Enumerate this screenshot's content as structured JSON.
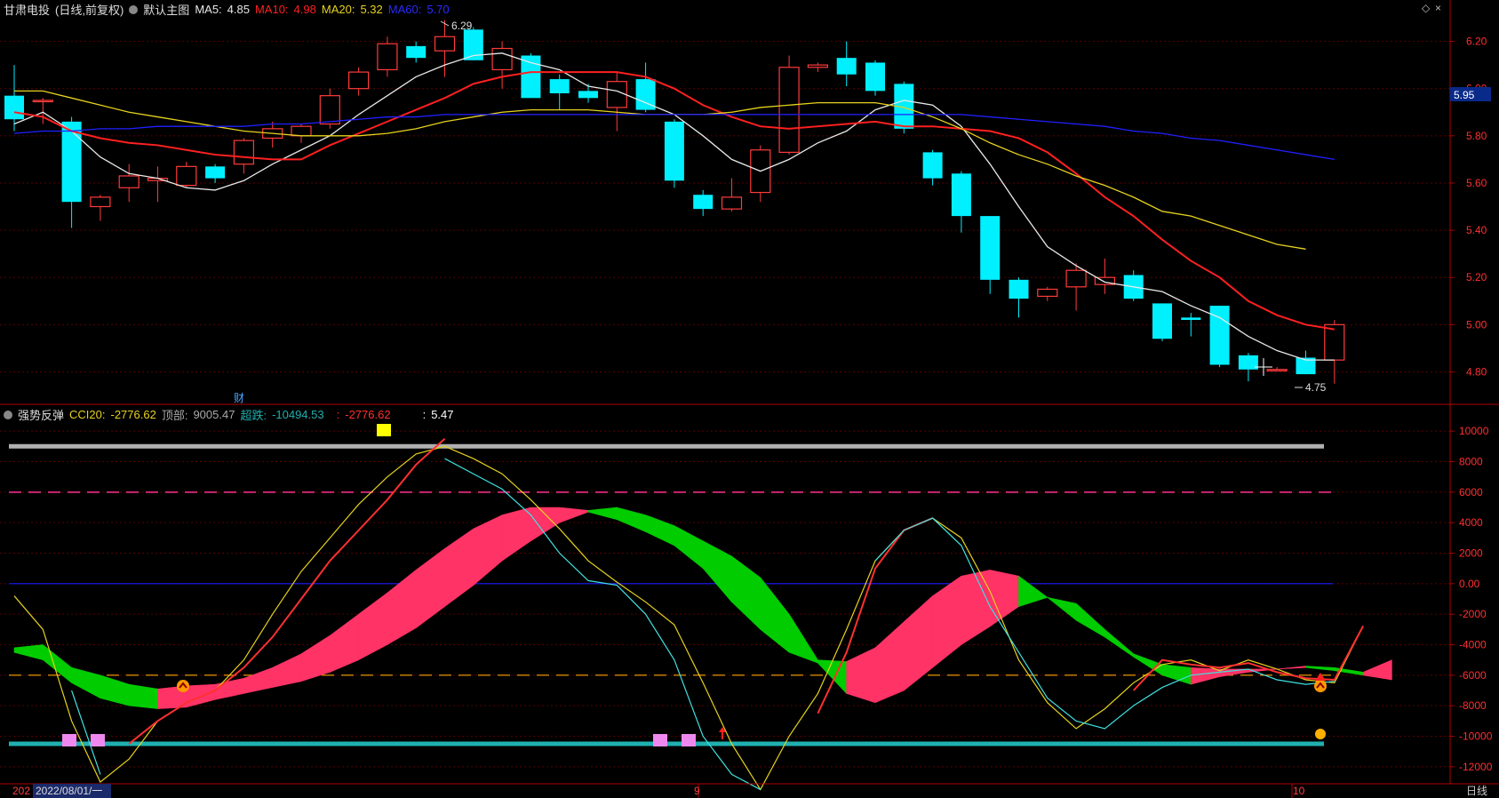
{
  "main_header": {
    "stock": "甘肃电投",
    "period": "(日线,前复权)",
    "theme": "默认主图",
    "ma5": {
      "label": "MA5:",
      "value": "4.85",
      "color": "#e8e8e8"
    },
    "ma10": {
      "label": "MA10:",
      "value": "4.98",
      "color": "#ff2020"
    },
    "ma20": {
      "label": "MA20:",
      "value": "5.32",
      "color": "#e6d21e"
    },
    "ma60": {
      "label": "MA60:",
      "value": "5.70",
      "color": "#2020ff"
    }
  },
  "sub_header": {
    "name": "强势反弹",
    "cci": {
      "label": "CCI20:",
      "value": "-2776.62",
      "color": "#e6d21e"
    },
    "top": {
      "label": "顶部:",
      "value": "9005.47",
      "color": "#aaaaaa"
    },
    "oversold": {
      "label": "超跌:",
      "value": "-10494.53",
      "color": "#20b0b0"
    },
    "red": {
      "label": ":",
      "value": "-2776.62",
      "color": "#ff3030"
    },
    "white": {
      "label": ":",
      "value": "5.47",
      "color": "#ffffff"
    }
  },
  "price_tag": "5.95",
  "finance_marker": "财",
  "annotations": {
    "high": "6.29",
    "low": "4.75"
  },
  "x_labels": {
    "start": "202",
    "cursor_date": "2022/08/01/一",
    "m9": "9",
    "m10": "10",
    "period": "日线"
  },
  "chart_data": [
    {
      "type": "candlestick",
      "title": "甘肃电投 (日线,前复权)",
      "ylim": [
        4.7,
        6.3
      ],
      "yticks": [
        4.8,
        5.0,
        5.2,
        5.4,
        5.6,
        5.8,
        6.0,
        6.2
      ],
      "colors": {
        "up": "#ff3b3b",
        "down": "#00f0ff"
      },
      "ohlc": [
        [
          5.97,
          6.1,
          5.82,
          5.87
        ],
        [
          5.95,
          5.96,
          5.85,
          5.95
        ],
        [
          5.86,
          5.88,
          5.41,
          5.52
        ],
        [
          5.5,
          5.55,
          5.44,
          5.54
        ],
        [
          5.58,
          5.68,
          5.52,
          5.63
        ],
        [
          5.61,
          5.67,
          5.52,
          5.62
        ],
        [
          5.59,
          5.69,
          5.58,
          5.67
        ],
        [
          5.67,
          5.68,
          5.6,
          5.62
        ],
        [
          5.68,
          5.79,
          5.64,
          5.78
        ],
        [
          5.79,
          5.86,
          5.75,
          5.83
        ],
        [
          5.8,
          5.85,
          5.77,
          5.84
        ],
        [
          5.85,
          6.0,
          5.83,
          5.97
        ],
        [
          6.0,
          6.09,
          5.97,
          6.07
        ],
        [
          6.08,
          6.22,
          6.05,
          6.19
        ],
        [
          6.18,
          6.2,
          6.11,
          6.13
        ],
        [
          6.16,
          6.29,
          6.05,
          6.22
        ],
        [
          6.25,
          6.26,
          6.12,
          6.12
        ],
        [
          6.08,
          6.2,
          6.0,
          6.17
        ],
        [
          6.14,
          6.15,
          5.98,
          5.96
        ],
        [
          6.04,
          6.06,
          5.91,
          5.98
        ],
        [
          5.99,
          6.02,
          5.94,
          5.96
        ],
        [
          5.92,
          6.07,
          5.82,
          6.03
        ],
        [
          6.04,
          6.11,
          5.9,
          5.91
        ],
        [
          5.86,
          5.87,
          5.58,
          5.61
        ],
        [
          5.55,
          5.57,
          5.46,
          5.49
        ],
        [
          5.49,
          5.62,
          5.48,
          5.54
        ],
        [
          5.56,
          5.76,
          5.52,
          5.74
        ],
        [
          5.73,
          6.14,
          5.72,
          6.09
        ],
        [
          6.09,
          6.11,
          6.07,
          6.1
        ],
        [
          6.13,
          6.2,
          6.01,
          6.06
        ],
        [
          6.11,
          6.12,
          5.97,
          5.99
        ],
        [
          6.02,
          6.03,
          5.81,
          5.83
        ],
        [
          5.73,
          5.74,
          5.59,
          5.62
        ],
        [
          5.64,
          5.65,
          5.39,
          5.46
        ],
        [
          5.46,
          5.46,
          5.13,
          5.19
        ],
        [
          5.19,
          5.2,
          5.03,
          5.11
        ],
        [
          5.12,
          5.16,
          5.1,
          5.15
        ],
        [
          5.16,
          5.26,
          5.06,
          5.23
        ],
        [
          5.17,
          5.28,
          5.13,
          5.2
        ],
        [
          5.21,
          5.23,
          5.1,
          5.11
        ],
        [
          5.09,
          5.09,
          4.93,
          4.94
        ],
        [
          5.03,
          5.05,
          4.95,
          5.02
        ],
        [
          5.08,
          5.08,
          4.82,
          4.83
        ],
        [
          4.87,
          4.88,
          4.76,
          4.81
        ],
        [
          4.81,
          4.82,
          4.81,
          4.81
        ],
        [
          4.86,
          4.89,
          4.79,
          4.79
        ],
        [
          4.85,
          5.02,
          4.75,
          5.0
        ]
      ],
      "series": [
        {
          "name": "MA5",
          "color": "#e8e8e8",
          "values": [
            5.85,
            5.9,
            5.82,
            5.71,
            5.64,
            5.62,
            5.58,
            5.57,
            5.61,
            5.68,
            5.74,
            5.8,
            5.89,
            5.97,
            6.05,
            6.1,
            6.14,
            6.15,
            6.11,
            6.08,
            6.01,
            5.99,
            5.94,
            5.89,
            5.8,
            5.7,
            5.65,
            5.7,
            5.77,
            5.82,
            5.91,
            5.95,
            5.93,
            5.84,
            5.68,
            5.5,
            5.33,
            5.25,
            5.18,
            5.16,
            5.14,
            5.08,
            5.03,
            4.95,
            4.89,
            4.85,
            4.85
          ]
        },
        {
          "name": "MA10",
          "color": "#ff2020",
          "values": [
            5.9,
            5.88,
            5.82,
            5.79,
            5.77,
            5.76,
            5.74,
            5.72,
            5.71,
            5.7,
            5.7,
            5.76,
            5.81,
            5.86,
            5.91,
            5.96,
            6.02,
            6.05,
            6.07,
            6.07,
            6.07,
            6.07,
            6.05,
            6.0,
            5.93,
            5.88,
            5.84,
            5.83,
            5.84,
            5.85,
            5.86,
            5.84,
            5.84,
            5.83,
            5.82,
            5.79,
            5.73,
            5.64,
            5.54,
            5.46,
            5.36,
            5.27,
            5.2,
            5.1,
            5.04,
            5.0,
            4.98
          ]
        },
        {
          "name": "MA20",
          "color": "#e6d21e",
          "values": [
            5.99,
            5.99,
            5.96,
            5.93,
            5.9,
            5.88,
            5.86,
            5.84,
            5.82,
            5.81,
            5.8,
            5.8,
            5.8,
            5.81,
            5.83,
            5.86,
            5.88,
            5.9,
            5.91,
            5.91,
            5.91,
            5.9,
            5.89,
            5.89,
            5.89,
            5.9,
            5.92,
            5.93,
            5.94,
            5.94,
            5.94,
            5.92,
            5.88,
            5.83,
            5.77,
            5.72,
            5.68,
            5.63,
            5.59,
            5.54,
            5.48,
            5.46,
            5.42,
            5.38,
            5.34,
            5.32
          ]
        },
        {
          "name": "MA60",
          "color": "#2020ff",
          "values": [
            5.81,
            5.82,
            5.82,
            5.83,
            5.83,
            5.84,
            5.84,
            5.84,
            5.84,
            5.85,
            5.85,
            5.86,
            5.87,
            5.88,
            5.88,
            5.89,
            5.89,
            5.89,
            5.89,
            5.89,
            5.89,
            5.89,
            5.89,
            5.89,
            5.89,
            5.89,
            5.89,
            5.89,
            5.89,
            5.89,
            5.89,
            5.89,
            5.89,
            5.89,
            5.88,
            5.87,
            5.86,
            5.85,
            5.84,
            5.82,
            5.81,
            5.79,
            5.78,
            5.76,
            5.74,
            5.72,
            5.7
          ]
        }
      ]
    },
    {
      "type": "line",
      "title": "强势反弹",
      "ylim": [
        -13000,
        11000
      ],
      "yticks": [
        10000,
        8000,
        6000,
        4000,
        2000,
        0,
        -2000,
        -4000,
        -6000,
        -8000,
        -10000,
        -12000
      ],
      "hlines": [
        {
          "value": 9005.47,
          "color": "#b0b0b0",
          "style": "solid",
          "width": 5
        },
        {
          "value": 6000,
          "color": "#ff3090",
          "style": "dashed",
          "width": 1.5
        },
        {
          "value": 0,
          "color": "#1a1aff",
          "style": "solid",
          "width": 1.2
        },
        {
          "value": -6000,
          "color": "#ffa500",
          "style": "dashed",
          "width": 1.2
        },
        {
          "value": -10494.53,
          "color": "#20b0b0",
          "style": "solid",
          "width": 5
        }
      ],
      "series": [
        {
          "name": "CCI20",
          "color": "#e6d21e",
          "values": [
            -800,
            -3000,
            -9000,
            -13000,
            -11500,
            -9000,
            -7800,
            -7000,
            -5000,
            -2000,
            800,
            3000,
            5200,
            7000,
            8500,
            9005,
            8200,
            7200,
            5500,
            3600,
            1500,
            100,
            -1200,
            -2700,
            -6500,
            -10500,
            -13500,
            -10000,
            -7200,
            -3000,
            1500,
            3500,
            4300,
            3000,
            -500,
            -5000,
            -7800,
            -9500,
            -8200,
            -6500,
            -5300,
            -5000,
            -5700,
            -5000,
            -5600,
            -6300,
            -6500,
            -2776.62
          ]
        },
        {
          "name": "MA",
          "color": "#ff3030",
          "values": [
            null,
            null,
            null,
            null,
            -10500,
            -9000,
            -7800,
            -7000,
            -5500,
            -3500,
            -1000,
            1500,
            3500,
            5500,
            7800,
            9500,
            null,
            null,
            null,
            null,
            null,
            null,
            null,
            null,
            null,
            null,
            null,
            null,
            -8500,
            -4500,
            1000,
            3500,
            4300,
            null,
            null,
            null,
            null,
            null,
            null,
            -7000,
            -5000,
            -5300,
            -5500,
            -5200,
            -5800,
            -6200,
            -6300,
            -2776.62
          ]
        },
        {
          "name": "Cyan",
          "color": "#40e0e0",
          "values": [
            null,
            null,
            -7000,
            -12500,
            null,
            null,
            null,
            null,
            null,
            null,
            null,
            null,
            null,
            null,
            null,
            8200,
            7200,
            6200,
            4500,
            2000,
            200,
            -100,
            -2000,
            -5000,
            -10000,
            -12500,
            -13500,
            null,
            null,
            null,
            1500,
            3500,
            4300,
            2500,
            -1500,
            -4500,
            -7500,
            -9000,
            -9500,
            -8000,
            -6800,
            -6000,
            -5800,
            -5600,
            -6300,
            -6600,
            -6400,
            null
          ]
        }
      ],
      "band_upper": [
        -4200,
        -4000,
        -5500,
        -6000,
        -6600,
        -6900,
        -6700,
        -6600,
        -6200,
        -5500,
        -4600,
        -3400,
        -2000,
        -600,
        900,
        2300,
        3600,
        4500,
        5000,
        5000,
        4800,
        4200,
        3400,
        2500,
        1000,
        -1200,
        -3000,
        -4500,
        -5200,
        -5100,
        -4200,
        -2500,
        -800,
        500,
        900,
        500,
        -900,
        -2400,
        -3500,
        -4600,
        -5300,
        -5500,
        -5600,
        -5600,
        -5600,
        -5500,
        -5700,
        -6000,
        -5000
      ],
      "band_lower": [
        -4500,
        -5000,
        -6500,
        -7500,
        -8000,
        -8200,
        -8100,
        -7600,
        -7200,
        -6800,
        -6400,
        -5800,
        -5000,
        -4000,
        -2900,
        -1500,
        -100,
        1500,
        2800,
        4000,
        4700,
        5000,
        4500,
        3800,
        2800,
        1800,
        400,
        -2000,
        -5000,
        -7200,
        -7800,
        -7000,
        -5500,
        -4000,
        -2800,
        -1500,
        -900,
        -1300,
        -3000,
        -4800,
        -6000,
        -6600,
        -6100,
        -5800,
        -5600,
        -5400,
        -5500,
        -5800,
        -6300
      ]
    }
  ]
}
